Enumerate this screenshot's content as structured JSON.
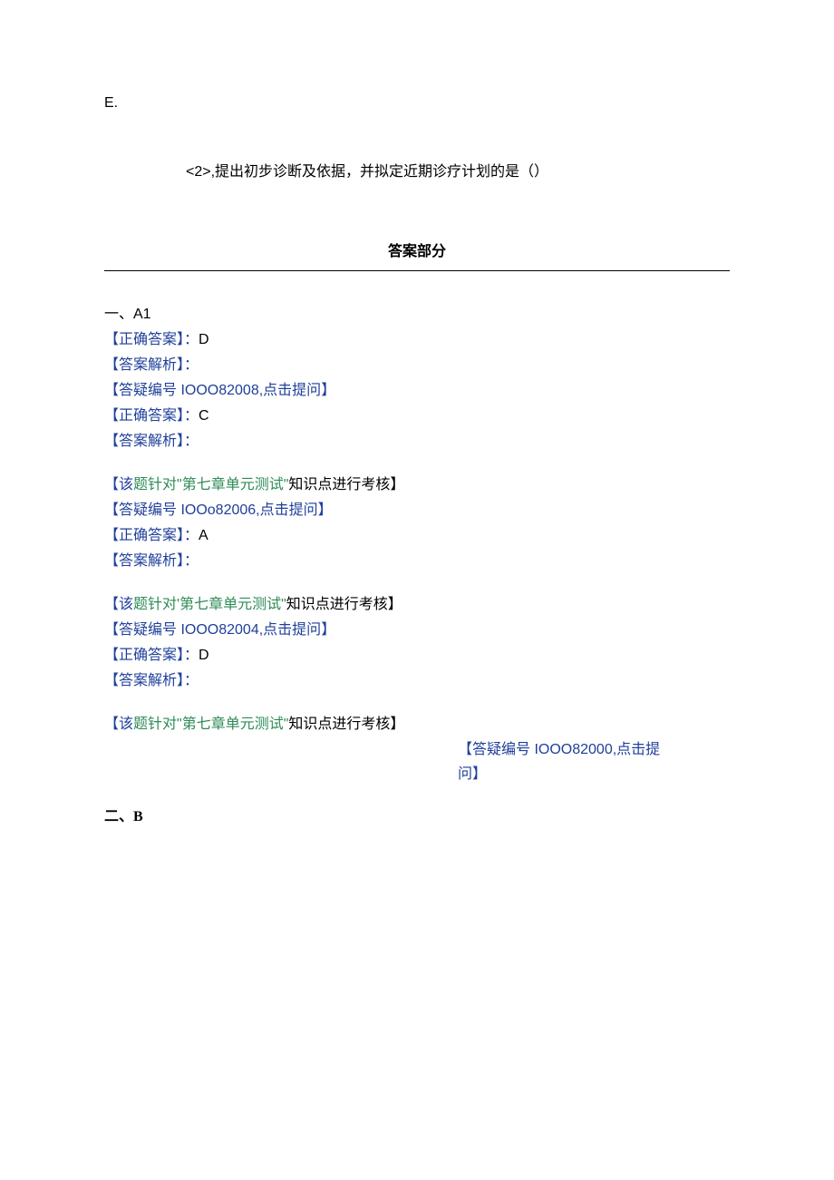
{
  "top": {
    "e": "E.",
    "q2": "<2>,提出初步诊断及依据，并拟定近期诊疗计划的是（）"
  },
  "answers_title": "答案部分",
  "section_a_heading": "一、A1",
  "blocks": [
    {
      "correct_pre": "【正确答案】：",
      "correct_val": "D",
      "analysis": "【答案解析】：",
      "assess_pre": "",
      "assess_mid": "",
      "assess_post": "",
      "ref_pre": "【答疑编号 IOOO82008,",
      "ref_link": "点击提问",
      "ref_post": "】"
    },
    {
      "correct_pre": "【正确答案】：",
      "correct_val": "C",
      "analysis": "【答案解析】：",
      "assess_pre": "【该",
      "assess_mid": "题针对\"第七章单元测试\"",
      "assess_post": "知识点进行考核】",
      "ref_pre": "【答疑编号 IOOo82006,",
      "ref_link": "点击提问",
      "ref_post": "】"
    },
    {
      "correct_pre": "【正确答案】：",
      "correct_val": "A",
      "analysis": "【答案解析】：",
      "assess_pre": "【该",
      "assess_mid": "题针对'第七章单元测试\"",
      "assess_post": "知识点进行考核】",
      "ref_pre": "【答疑编号 IOOO82004,",
      "ref_link": "点击提问",
      "ref_post": "】"
    },
    {
      "correct_pre": "【正确答案】：",
      "correct_val": "D",
      "analysis": "【答案解析】：",
      "assess_pre": "【该",
      "assess_mid": "题针对\"第七章单元测试\"",
      "assess_post": "知识点进行考核】",
      "ref_pre": "【答疑编号 IOOO82000,",
      "ref_link": "点击提",
      "ref_post": "问】"
    }
  ],
  "section_b_heading": "二、B"
}
